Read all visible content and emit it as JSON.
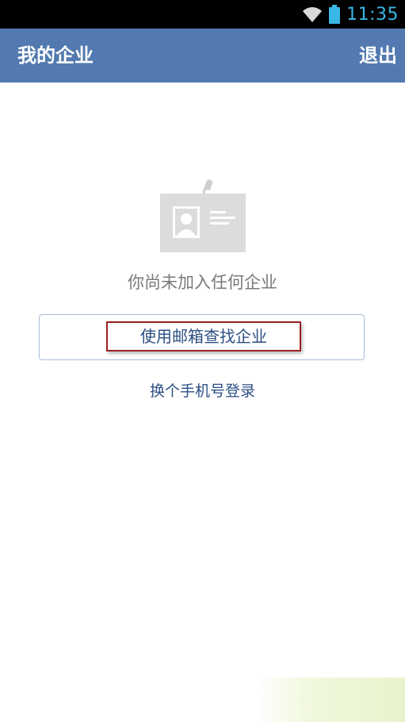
{
  "status_bar": {
    "time": "11:35",
    "icons": [
      "wifi-icon",
      "battery-icon"
    ],
    "time_color": "#39b7e6"
  },
  "app_bar": {
    "title": "我的企业",
    "logout_label": "退出",
    "background_color": "#527ab0"
  },
  "empty_state": {
    "icon": "id-card-icon",
    "message": "你尚未加入任何企业"
  },
  "actions": {
    "email_search_label": "使用邮箱查找企业",
    "phone_login_label": "换个手机号登录",
    "link_color": "#2c4f84",
    "highlight_color": "#9a1f22"
  }
}
